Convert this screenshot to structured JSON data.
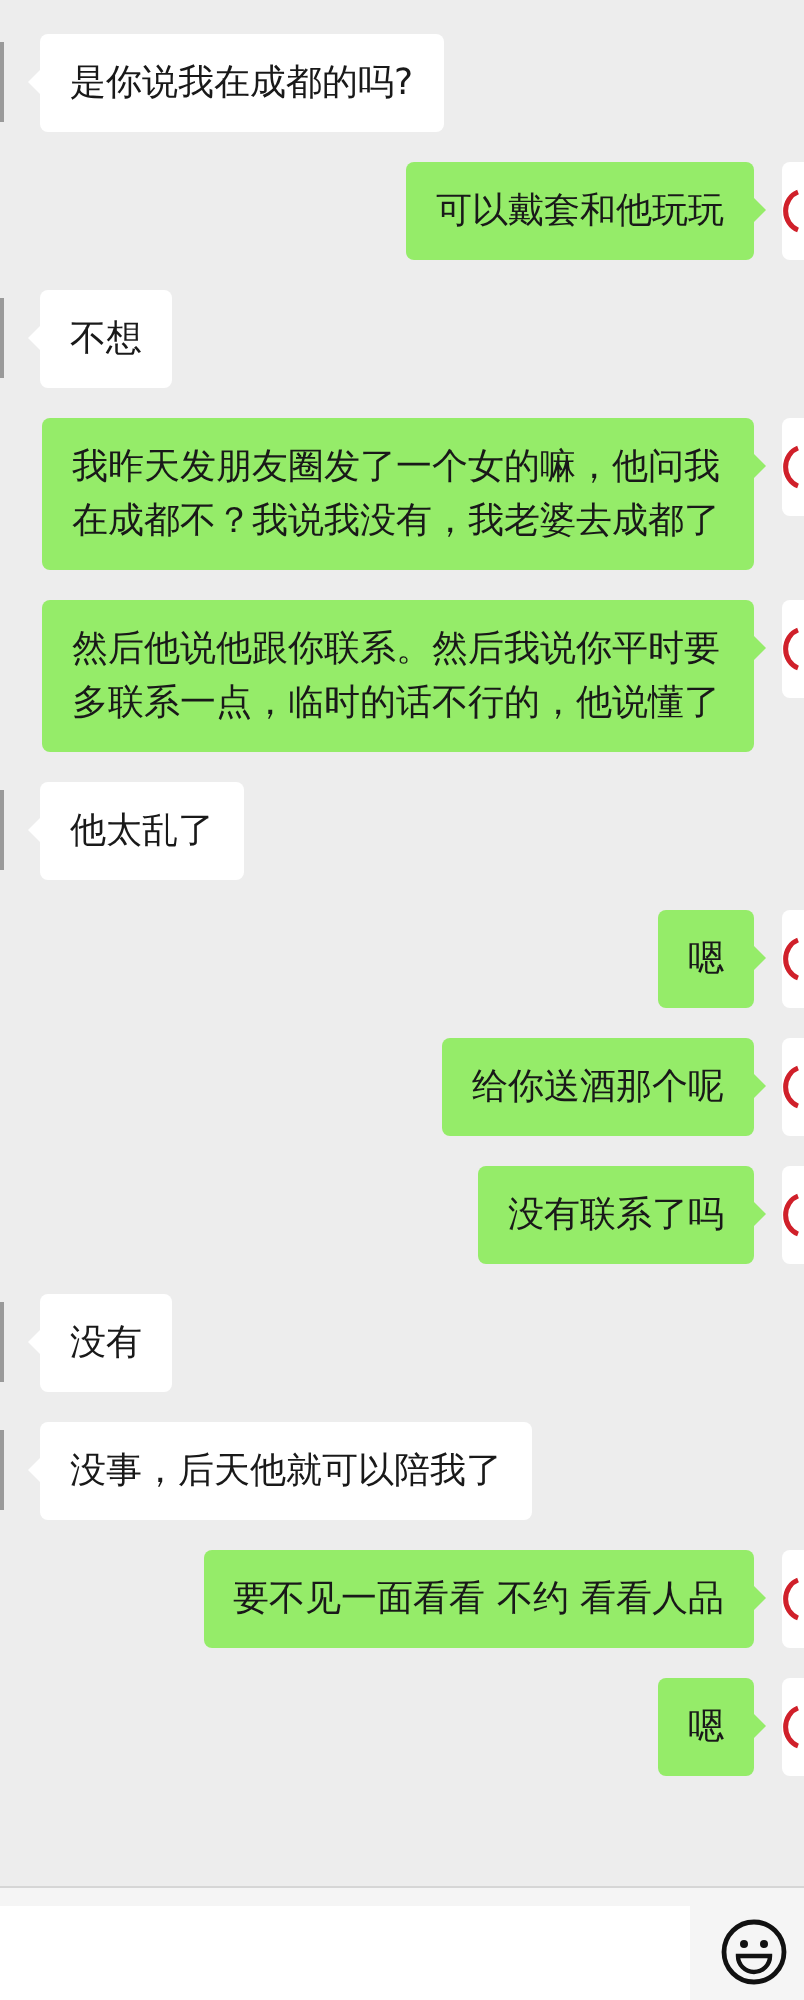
{
  "messages": [
    {
      "kind": "received",
      "text": "是你说我在成都的吗?"
    },
    {
      "kind": "sent",
      "text": "可以戴套和他玩玩"
    },
    {
      "kind": "received",
      "text": "不想"
    },
    {
      "kind": "sent",
      "text": "我昨天发朋友圈发了一个女的嘛，他问我在成都不？我说我没有，我老婆去成都了"
    },
    {
      "kind": "sent",
      "text": "然后他说他跟你联系。然后我说你平时要多联系一点，临时的话不行的，他说懂了"
    },
    {
      "kind": "received",
      "text": "他太乱了"
    },
    {
      "kind": "sent",
      "text": "嗯"
    },
    {
      "kind": "sent",
      "text": "给你送酒那个呢"
    },
    {
      "kind": "sent",
      "text": "没有联系了吗"
    },
    {
      "kind": "received",
      "text": "没有"
    },
    {
      "kind": "received",
      "text": "没事，后天他就可以陪我了"
    },
    {
      "kind": "sent",
      "text": "要不见一面看看 不约  看看人品"
    },
    {
      "kind": "sent",
      "text": "嗯"
    }
  ]
}
